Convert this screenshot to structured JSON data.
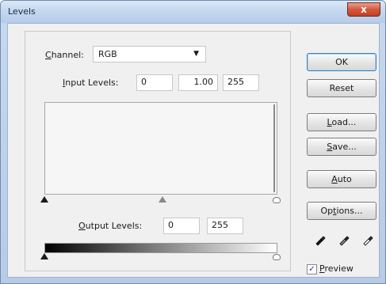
{
  "window": {
    "title": "Levels",
    "close_symbol": "x"
  },
  "channel": {
    "label_first": "C",
    "label_rest": "hannel:",
    "value": "RGB",
    "arrow_symbol": "▼"
  },
  "input_levels": {
    "label_first": "I",
    "label_rest": "nput Levels:",
    "black": "0",
    "gamma": "1.00",
    "white": "255"
  },
  "output_levels": {
    "label_first": "O",
    "label_rest": "utput Levels:",
    "black": "0",
    "white": "255"
  },
  "buttons": {
    "ok": "OK",
    "reset": "Reset",
    "load_first": "L",
    "load_rest": "oad...",
    "save_first": "S",
    "save_rest": "ave...",
    "auto_first": "A",
    "auto_rest": "uto",
    "options_pre": "Op",
    "options_u": "t",
    "options_post": "ions..."
  },
  "preview": {
    "checked": true,
    "check_symbol": "✓",
    "label_first": "P",
    "label_rest": "review"
  },
  "icons": {
    "black_eyedropper": "black-eyedropper-icon",
    "gray_eyedropper": "gray-eyedropper-icon",
    "white_eyedropper": "white-eyedropper-icon"
  }
}
